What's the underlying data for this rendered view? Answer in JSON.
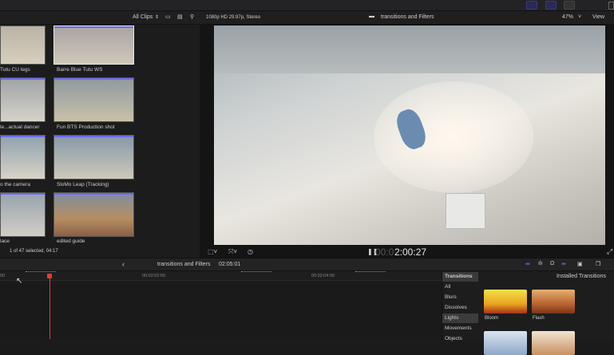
{
  "browser": {
    "filter": "All Clips",
    "clips": [
      {
        "label": "Tutu CU legs"
      },
      {
        "label": "Barre Blue Tutu WS"
      },
      {
        "label": "le...actual dancer"
      },
      {
        "label": "Fun BTS Production shot"
      },
      {
        "label": "o the camera"
      },
      {
        "label": "SloMo Leap (Tracking)"
      },
      {
        "label": "lace"
      },
      {
        "label": "edited guide"
      }
    ],
    "status": "1 of 47 selected, 04:17"
  },
  "viewer": {
    "format": "1080p HD 29.97p, Stereo",
    "title": "transitions and Filters",
    "zoom": "47%",
    "view_label": "View",
    "timecode_dim": "00:0",
    "timecode": "2:00:27"
  },
  "timeline": {
    "project": "transitions and Filters",
    "duration": "02:05:01",
    "ruler": [
      "00",
      "00:02:02:00",
      "00:02:04:00"
    ]
  },
  "effects": {
    "header": "Transitions",
    "installed": "Installed Transitions",
    "categories": [
      "All",
      "Blurs",
      "Dissolves",
      "Lights",
      "Movements",
      "Objects"
    ],
    "selected_category": "Lights",
    "items": [
      {
        "label": "Bloom"
      },
      {
        "label": "Flash"
      }
    ]
  },
  "colors": {
    "accent": "#6c6cf0",
    "playhead": "#d9422f"
  }
}
